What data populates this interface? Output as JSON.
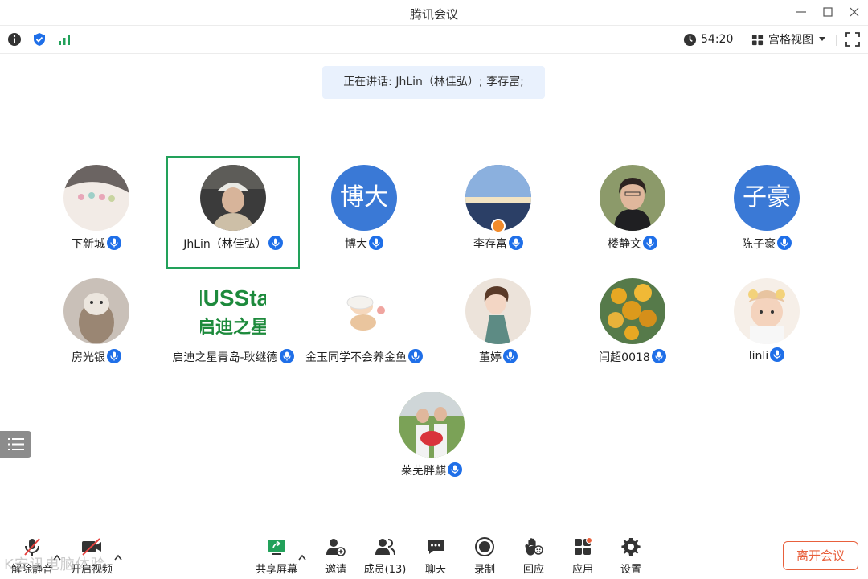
{
  "window": {
    "title": "腾讯会议"
  },
  "infobar": {
    "timer": "54:20",
    "view_mode": "宫格视图"
  },
  "speaking": {
    "text": "正在讲话: JhLin（林佳弘）; 李存富;"
  },
  "participants": [
    {
      "name": "下新城",
      "avatar": "photo"
    },
    {
      "name": "JhLin（林佳弘）",
      "avatar": "photo",
      "active": true
    },
    {
      "name": "博大",
      "avatar": "text",
      "avatar_text": "博大"
    },
    {
      "name": "李存富",
      "avatar": "photo",
      "host": true
    },
    {
      "name": "楼静文",
      "avatar": "photo"
    },
    {
      "name": "陈子豪",
      "avatar": "text",
      "avatar_text": "子豪"
    },
    {
      "name": "房光银",
      "avatar": "photo"
    },
    {
      "name": "启迪之星青岛-耿继德",
      "avatar": "logo",
      "logo_text": [
        "IUSSta",
        "启迪之星"
      ]
    },
    {
      "name": "金玉同学不会养金鱼",
      "avatar": "photo"
    },
    {
      "name": "董婷",
      "avatar": "photo"
    },
    {
      "name": "闫超0018",
      "avatar": "photo"
    },
    {
      "name": "linli",
      "avatar": "photo"
    },
    {
      "name": "莱芜胖麒",
      "avatar": "photo"
    }
  ],
  "toolbar": {
    "unmute": "解除静音",
    "start_video": "开启视频",
    "share_screen": "共享屏幕",
    "invite": "邀请",
    "members": "成员(13)",
    "chat": "聊天",
    "record": "录制",
    "react": "回应",
    "apps": "应用",
    "settings": "设置",
    "leave": "离开会议"
  },
  "watermark": "K安讯电脑体验",
  "colors": {
    "accent": "#1f6fe8",
    "active_border": "#22a15a",
    "leave": "#e8603c",
    "avatar_bg": "#3a79d6"
  }
}
